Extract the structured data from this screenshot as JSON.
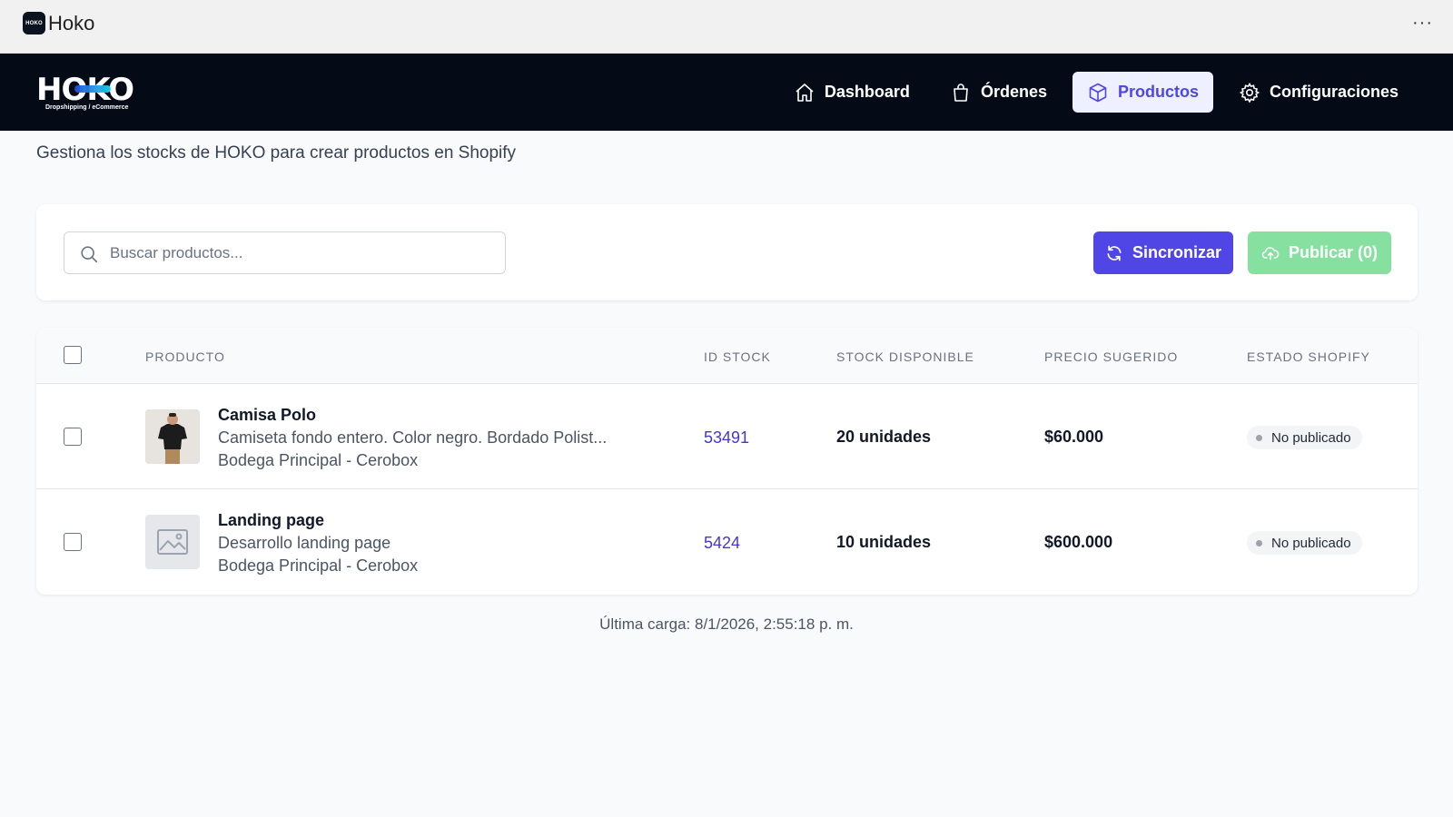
{
  "window": {
    "app_title": "Hoko",
    "app_icon_text": "HOKO",
    "more_label": "···"
  },
  "brand": {
    "logo_text": "HOKO",
    "tagline": "Dropshipping / eCommerce"
  },
  "nav": {
    "items": [
      {
        "label": "Dashboard",
        "icon": "home-icon"
      },
      {
        "label": "Órdenes",
        "icon": "shopping-bag-icon"
      },
      {
        "label": "Productos",
        "icon": "cube-icon",
        "active": true
      },
      {
        "label": "Configuraciones",
        "icon": "gear-icon"
      }
    ]
  },
  "page": {
    "subtitle": "Gestiona los stocks de HOKO para crear productos en Shopify"
  },
  "toolbar": {
    "search_placeholder": "Buscar productos...",
    "sync_label": "Sincronizar",
    "publish_label": "Publicar (0)"
  },
  "table": {
    "headers": [
      "PRODUCTO",
      "ID STOCK",
      "STOCK DISPONIBLE",
      "PRECIO SUGERIDO",
      "ESTADO SHOPIFY"
    ],
    "rows": [
      {
        "name": "Camisa Polo",
        "description": "Camiseta fondo entero. Color negro. Bordado Polist...",
        "warehouse": "Bodega Principal - Cerobox",
        "id_stock": "53491",
        "stock": "20 unidades",
        "price": "$60.000",
        "status": "No publicado",
        "thumb": "shirt-photo"
      },
      {
        "name": "Landing page",
        "description": "Desarrollo landing page",
        "warehouse": "Bodega Principal - Cerobox",
        "id_stock": "5424",
        "stock": "10 unidades",
        "price": "$600.000",
        "status": "No publicado",
        "thumb": "image-placeholder-icon"
      }
    ]
  },
  "footer": {
    "last_load": "Última carga: 8/1/2026, 2:55:18 p. m."
  },
  "colors": {
    "accent": "#4f46e5",
    "nav_bg": "#050b16",
    "publish": "#86e0a0",
    "link": "#4338ca"
  }
}
